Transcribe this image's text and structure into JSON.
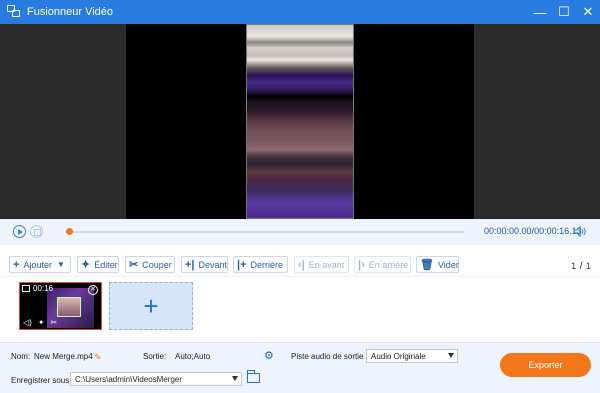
{
  "window": {
    "title": "Fusionneur Vidéo",
    "minimize": "—",
    "maximize": "☐",
    "close": "✕"
  },
  "player": {
    "time_current": "00:00:00.00",
    "time_separator": "/",
    "time_total": "00:00:16.13",
    "progress_fraction": 0
  },
  "toolbar": {
    "add_label": "Ajouter",
    "edit_label": "Éditer",
    "cut_label": "Couper",
    "front_label": "Devant",
    "back_label": "Derrière",
    "forward_label": "En avant",
    "backward_label": "En arrière",
    "clear_label": "Vider",
    "page_current": "1",
    "page_total": "1"
  },
  "clips": [
    {
      "duration": "00:16"
    }
  ],
  "footer": {
    "name_label": "Nom:",
    "name_value": "New Merge.mp4",
    "output_label": "Sortie:",
    "output_value": "Auto;Auto",
    "audio_label": "Piste audio de sortie :",
    "audio_value": "Audio Originale",
    "save_label": "Enregistrer sous:",
    "save_path": "C:\\Users\\admin\\VideosMerger",
    "export_label": "Exporter"
  },
  "colors": {
    "accent": "#2a7de0",
    "export": "#f5761a",
    "progress": "#f07a22"
  }
}
